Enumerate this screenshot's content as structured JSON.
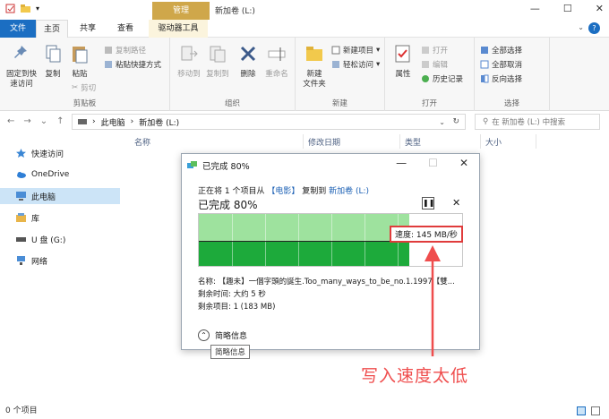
{
  "window": {
    "title": "新加卷 (L:)",
    "manage_tab": "管理",
    "minimize": "—",
    "maximize": "☐",
    "close": "✕"
  },
  "tabs": [
    "文件",
    "主页",
    "共享",
    "查看",
    "驱动器工具"
  ],
  "ribbon": {
    "pin": "固定到快\n速访问",
    "copy": "复制",
    "paste": "粘贴",
    "copy_path": "复制路径",
    "paste_shortcut": "粘贴快捷方式",
    "cut": "剪切",
    "clipboard": "剪贴板",
    "move_to": "移动到",
    "copy_to": "复制到",
    "delete": "删除",
    "rename": "重命名",
    "organize": "组织",
    "new_folder": "新建\n文件夹",
    "new_item": "新建项目",
    "easy_access": "轻松访问",
    "new": "新建",
    "properties": "属性",
    "open": "打开",
    "edit": "编辑",
    "history": "历史记录",
    "open_group": "打开",
    "select_all": "全部选择",
    "select_none": "全部取消",
    "invert": "反向选择",
    "select": "选择"
  },
  "address": {
    "path_pc": "此电脑",
    "path_vol": "新加卷 (L:)",
    "search_placeholder": "在 新加卷 (L:) 中搜索"
  },
  "sidebar": [
    {
      "label": "快速访问",
      "icon": "star-icon"
    },
    {
      "label": "OneDrive",
      "icon": "cloud-icon"
    },
    {
      "label": "此电脑",
      "icon": "computer-icon"
    },
    {
      "label": "库",
      "icon": "library-icon"
    },
    {
      "label": "U 盘 (G:)",
      "icon": "usb-drive-icon"
    },
    {
      "label": "网络",
      "icon": "network-icon"
    }
  ],
  "columns": [
    "名称",
    "修改日期",
    "类型",
    "大小"
  ],
  "status": "0 个项目",
  "dialog": {
    "title": "已完成 80%",
    "line_prefix": "正在将 1 个项目从",
    "source": "【电影】",
    "copy_to": "复制到",
    "target": "新加卷 (L:)",
    "percent_text": "已完成 80%",
    "progress_fraction": 0.8,
    "speed": "速度: 145 MB/秒",
    "name_line": "名称: 【趣未】一個字頭的誕生.Too_many_ways_to_be_no.1.1997【雙...",
    "time_line": "剩余时间: 大约 5 秒",
    "items_line": "剩余项目: 1 (183 MB)",
    "brief": "简略信息",
    "tooltip": "简略信息"
  },
  "annotation": "写入速度太低",
  "colors": {
    "accent": "#1b6ec2",
    "manage": "#cfa74a",
    "progress_light": "#9ee29e",
    "progress_dark": "#1daa3b",
    "annotation": "#ef4d4d"
  }
}
